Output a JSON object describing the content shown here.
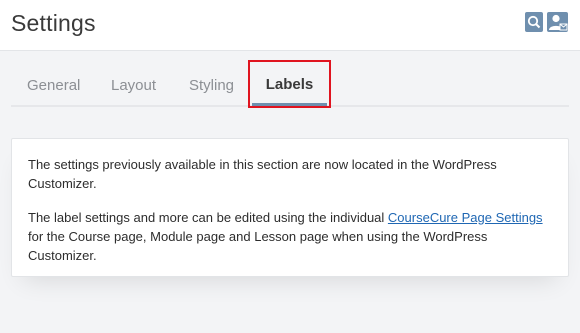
{
  "header": {
    "title": "Settings",
    "icons": [
      "search-icon",
      "user-icon"
    ]
  },
  "tabs": [
    {
      "label": "General",
      "active": false
    },
    {
      "label": "Layout",
      "active": false
    },
    {
      "label": "Styling",
      "active": false
    },
    {
      "label": "Labels",
      "active": true
    }
  ],
  "content": {
    "p1": "The settings previously available in this section are now located in the WordPress Customizer.",
    "p2_before": "The label settings and more can be edited using the individual ",
    "p2_link": "CourseCure Page Settings",
    "p2_after": " for the Course page, Module page and Lesson page when using the WordPress Customizer."
  },
  "colors": {
    "accent": "#6f8fae",
    "highlight_box": "#e0141f",
    "link": "#1f67b3"
  }
}
